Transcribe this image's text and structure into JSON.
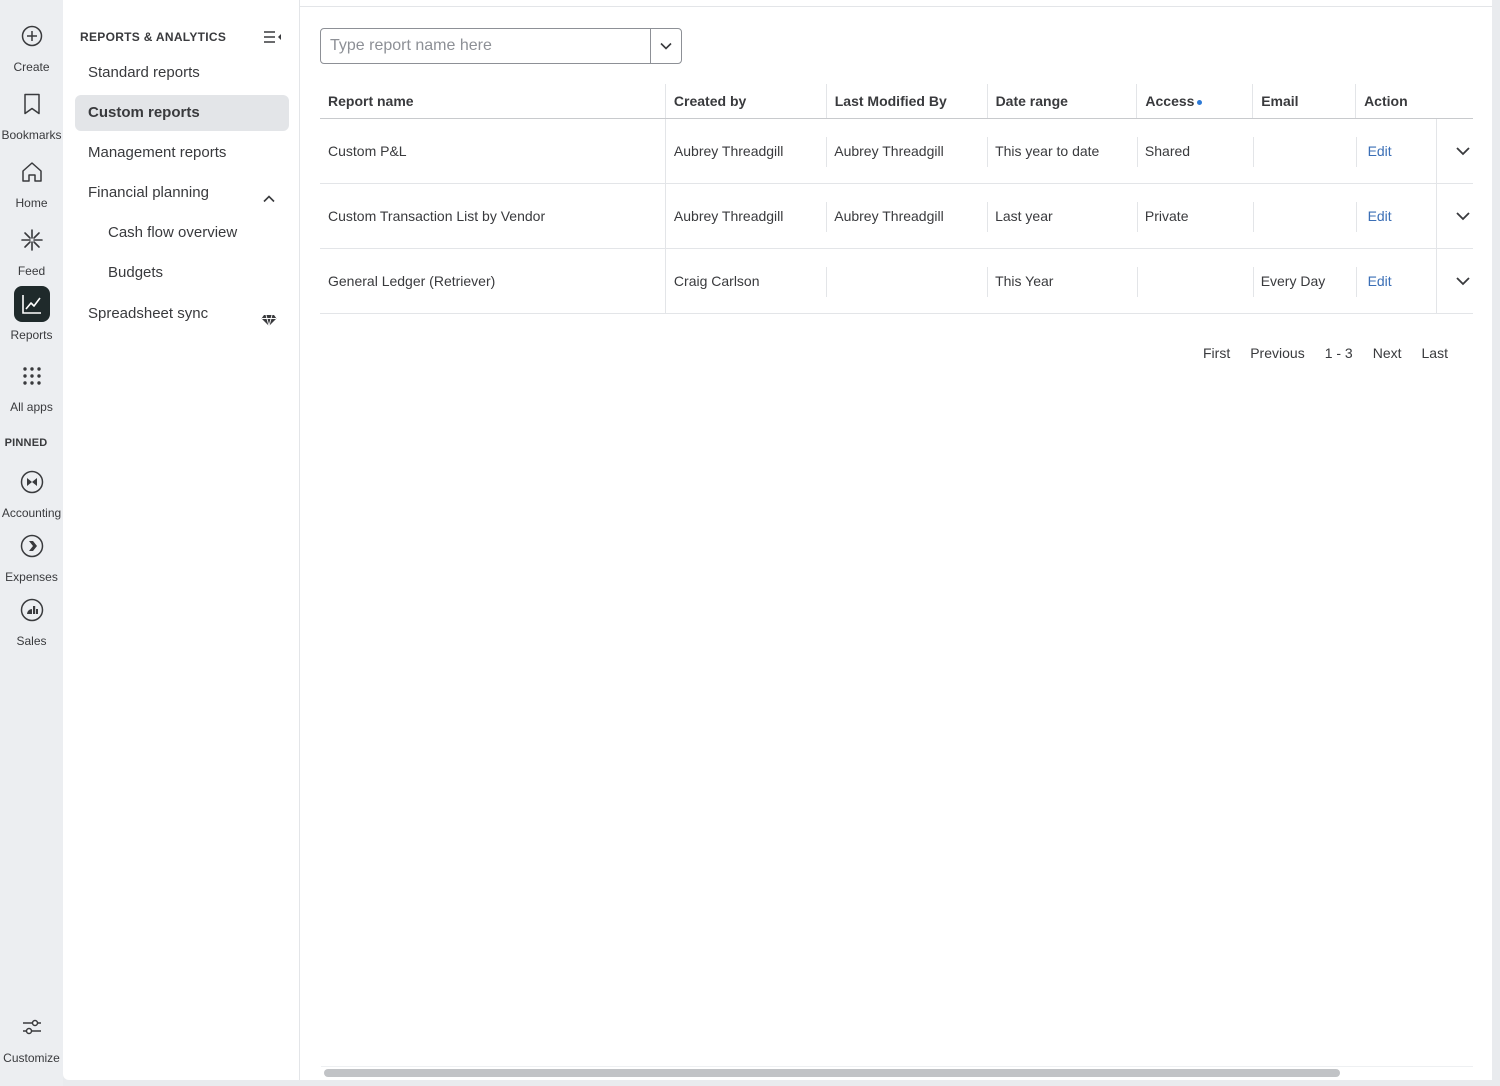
{
  "rail": {
    "create": "Create",
    "bookmarks": "Bookmarks",
    "home": "Home",
    "feed": "Feed",
    "reports": "Reports",
    "all_apps": "All apps",
    "pinned": "PINNED",
    "accounting": "Accounting",
    "expenses": "Expenses",
    "sales": "Sales",
    "customize": "Customize"
  },
  "subnav": {
    "title": "REPORTS & ANALYTICS",
    "items": [
      {
        "label": "Standard reports"
      },
      {
        "label": "Custom reports"
      },
      {
        "label": "Management reports"
      },
      {
        "label": "Financial planning"
      },
      {
        "label": "Cash flow overview"
      },
      {
        "label": "Budgets"
      },
      {
        "label": "Spreadsheet sync"
      }
    ]
  },
  "search": {
    "placeholder": "Type report name here",
    "value": ""
  },
  "table": {
    "headers": [
      "Report name",
      "Created by",
      "Last Modified By",
      "Date range",
      "Access",
      "Email",
      "Action"
    ],
    "rows": [
      {
        "name": "Custom P&L",
        "created_by": "Aubrey Threadgill",
        "modified_by": "Aubrey Threadgill",
        "date_range": "This year to date",
        "access": "Shared",
        "email": "",
        "action": "Edit"
      },
      {
        "name": "Custom Transaction List by Vendor",
        "created_by": "Aubrey Threadgill",
        "modified_by": "Aubrey Threadgill",
        "date_range": "Last year",
        "access": "Private",
        "email": "",
        "action": "Edit"
      },
      {
        "name": "General Ledger (Retriever)",
        "created_by": "Craig Carlson",
        "modified_by": "",
        "date_range": "This Year",
        "access": "",
        "email": "Every Day",
        "action": "Edit"
      }
    ]
  },
  "pager": {
    "first": "First",
    "previous": "Previous",
    "range": "1 - 3",
    "next": "Next",
    "last": "Last"
  },
  "colors": {
    "link": "#3b6fb6",
    "active_rail": "#1f2a2b",
    "access_dot": "#2d7ad6"
  }
}
